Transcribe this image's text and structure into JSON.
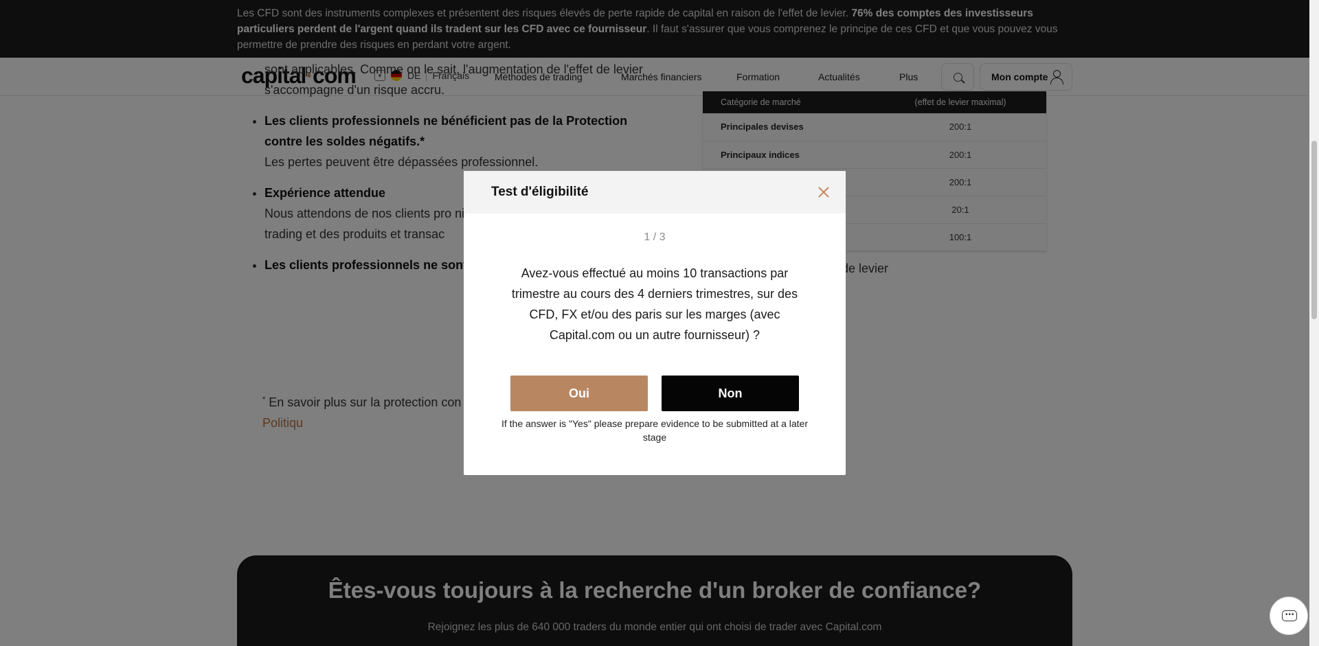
{
  "risk_banner": {
    "part1": "Les CFD sont des instruments complexes et présentent des risques élevés de perte rapide de capital en raison de l'effet de levier.",
    "bold": "76% des comptes des investisseurs particuliers perdent de l'argent quand ils tradent sur les CFD avec ce fournisseur",
    "part2": ". Il faut s'assurer que vous comprenez le principe de ces CFD et que vous pouvez vous permettre de prendre des risques en perdant votre argent."
  },
  "header": {
    "logo_main": "capital",
    "logo_dot": "·",
    "logo_end": "com",
    "country": "DE",
    "language": "Français",
    "nav": [
      "Méthodes de trading",
      "Marchés financiers",
      "Formation",
      "Actualités",
      "Plus"
    ],
    "account_label": "Mon compte"
  },
  "article": {
    "intro": "sont applicables. Comme on le sait, l'augmentation de l'effet de levier s'accompagne d'un risque accru.",
    "items": [
      {
        "title": "Les clients professionnels ne bénéficient pas de la Protection contre les soldes négatifs.*",
        "text": "Les pertes peuvent être dépassées professionnel."
      },
      {
        "title": "Expérience attendue",
        "text": "Nous attendons de nos clients pro niveau de connaissance et de co trading et des produits et transac"
      },
      {
        "title": "Les clients professionnels ne sont l'ICF/FSCS",
        "text": ""
      }
    ],
    "footnote_mark": "*",
    "footnote_text": " En savoir plus sur la protection con clients professionnels, voir la ",
    "footnote_link": "Politiqu",
    "side_text": "et de levier"
  },
  "leverage_table": {
    "header_left": "Catégorie de marché",
    "header_right": "(effet de levier maximal)",
    "rows": [
      {
        "category": "Principales devises",
        "value": "200:1"
      },
      {
        "category": "Principaux indices",
        "value": "200:1"
      },
      {
        "category": "",
        "value": "200:1"
      },
      {
        "category": "",
        "value": "20:1"
      },
      {
        "category": "",
        "value": "100:1"
      }
    ]
  },
  "cta": {
    "title": "Êtes-vous toujours à la recherche d'un broker de confiance?",
    "subtitle": "Rejoignez les plus de 640 000 traders du monde entier qui ont choisi de trader avec Capital.com"
  },
  "modal": {
    "title": "Test d'éligibilité",
    "step": "1 / 3",
    "question": "Avez-vous effectué au moins 10 transactions par trimestre au cours des 4 derniers trimestres, sur des CFD, FX et/ou des paris sur les marges (avec Capital.com ou un autre fournisseur) ?",
    "yes_label": "Oui",
    "no_label": "Non",
    "note": "If the answer is \"Yes\" please prepare evidence to be submitted at a later stage"
  },
  "colors": {
    "brand_accent": "#c8855a",
    "yes_button": "#b88762",
    "no_button": "#050505",
    "banner_bg": "#1c1c1c"
  },
  "icons": [
    "search-icon",
    "user-icon",
    "close-icon",
    "chat-icon",
    "chevron-down-icon",
    "flag-de-icon"
  ]
}
